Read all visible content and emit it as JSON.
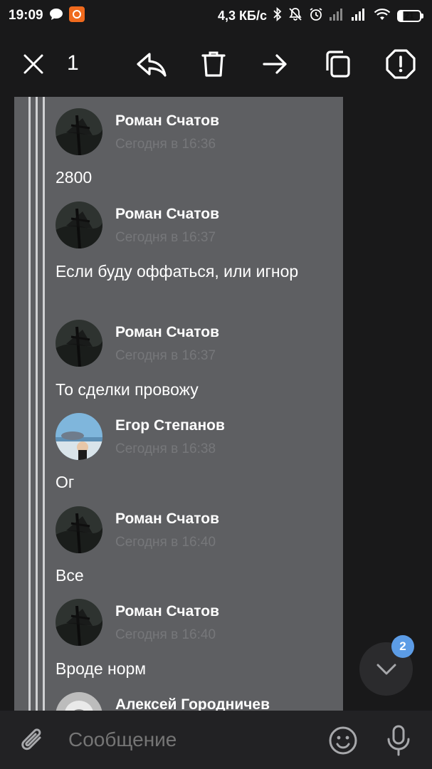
{
  "status_bar": {
    "time": "19:09",
    "network_speed": "4,3 КБ/с",
    "battery_level": "21",
    "icons": [
      "message-notification-icon",
      "app-notification-icon",
      "bluetooth-icon",
      "muted-bell-icon",
      "alarm-icon",
      "signal-icon",
      "signal-icon",
      "wifi-icon",
      "battery-icon"
    ]
  },
  "action_bar": {
    "selected_count": "1",
    "actions": [
      "close-icon",
      "reply-icon",
      "delete-icon",
      "forward-icon",
      "copy-icon",
      "report-icon"
    ]
  },
  "messages": [
    {
      "author": "Роман Счатов",
      "time": "Сегодня в 16:36",
      "text": "2800",
      "avatar": "dark-photo"
    },
    {
      "author": "Роман Счатов",
      "time": "Сегодня в 16:37",
      "text": "Если буду оффаться, или игнор",
      "avatar": "dark-photo"
    },
    {
      "author": "Роман Счатов",
      "time": "Сегодня в 16:37",
      "text": "То сделки провожу",
      "avatar": "dark-photo"
    },
    {
      "author": "Егор Степанов",
      "time": "Сегодня в 16:38",
      "text": "Ог",
      "avatar": "beach-photo"
    },
    {
      "author": "Роман Счатов",
      "time": "Сегодня в 16:40",
      "text": "Все",
      "avatar": "dark-photo"
    },
    {
      "author": "Роман Счатов",
      "time": "Сегодня в 16:40",
      "text": "Вроде норм",
      "avatar": "dark-photo"
    },
    {
      "author": "Алексей Городничев",
      "time": "",
      "text": "",
      "avatar": "portrait-photo"
    }
  ],
  "scroll_down": {
    "badge": "2"
  },
  "composer": {
    "placeholder": "Сообщение",
    "icons": [
      "attach-icon",
      "emoji-icon",
      "microphone-icon"
    ]
  },
  "colors": {
    "background": "#19191a",
    "bubble": "#5e5f62",
    "badge": "#5c9ce6",
    "time_text": "#76777a"
  }
}
